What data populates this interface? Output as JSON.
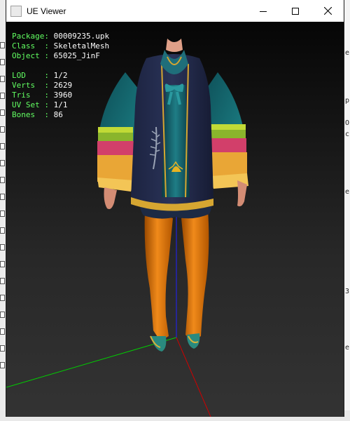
{
  "window": {
    "title": "UE Viewer",
    "controls": {
      "minimize": "minimize",
      "maximize": "maximize",
      "close": "close"
    }
  },
  "info": {
    "package_label": "Package:",
    "package_value": "00009235.upk",
    "class_label": "Class  :",
    "class_value": "SkeletalMesh",
    "object_label": "Object :",
    "object_value": "65025_JinF",
    "lod_label": "LOD    :",
    "lod_value": "1/2",
    "verts_label": "Verts  :",
    "verts_value": "2629",
    "tris_label": "Tris   :",
    "tris_value": "3960",
    "uvset_label": "UV Set :",
    "uvset_value": "1/1",
    "bones_label": "Bones  :",
    "bones_value": "86"
  },
  "colors": {
    "label_color": "#62ff62",
    "value_color": "#ffffff",
    "axis_x": "#d00000",
    "axis_y": "#00d000",
    "axis_z": "#2020ff"
  },
  "background": {
    "right_marks": [
      "e",
      "p",
      "O",
      "c",
      "e",
      "3",
      "e"
    ]
  }
}
